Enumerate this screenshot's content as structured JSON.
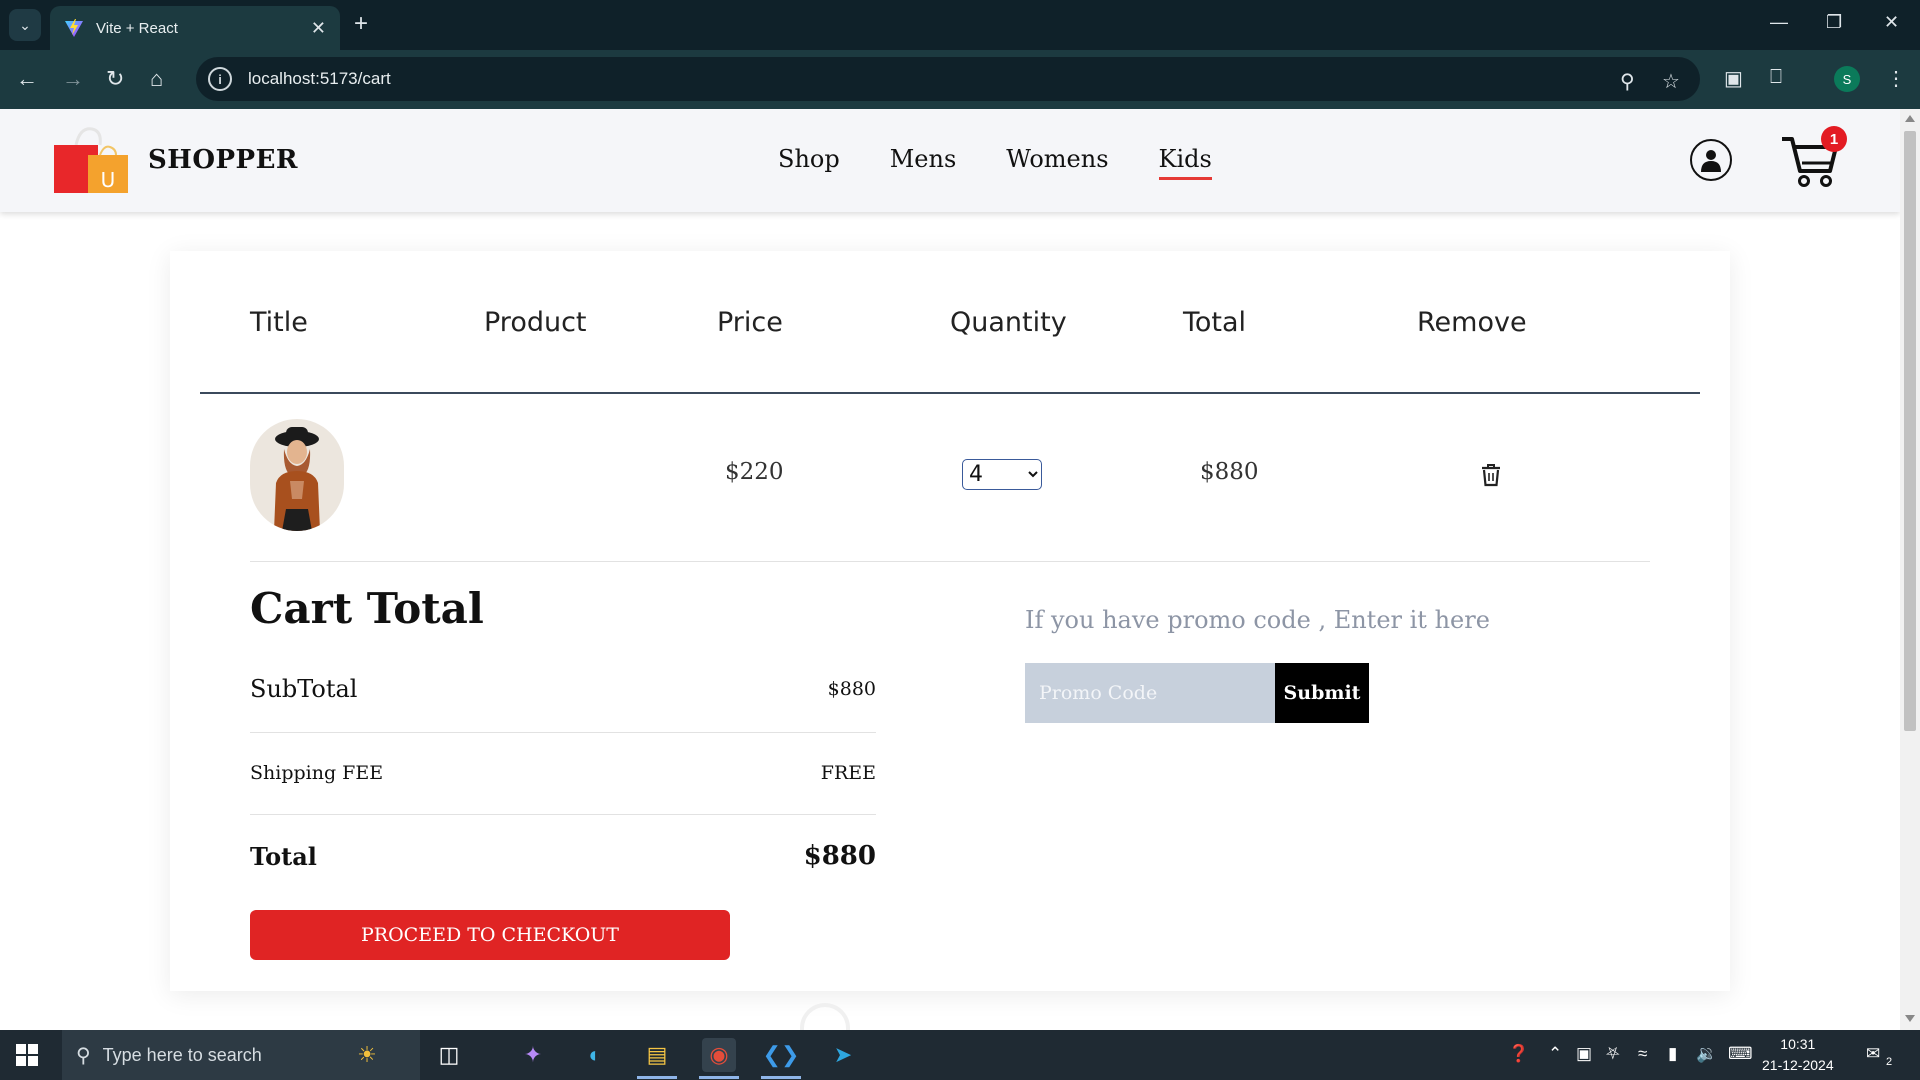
{
  "browser": {
    "tab_title": "Vite + React",
    "url": "localhost:5173/cart",
    "profile_initial": "S"
  },
  "site": {
    "brand": "SHOPPER",
    "nav": [
      "Shop",
      "Mens",
      "Womens",
      "Kids"
    ],
    "active_nav": "Kids",
    "cart_count": "1",
    "accent_color": "#e53935"
  },
  "cart": {
    "headers": [
      "Title",
      "Product",
      "Price",
      "Quantity",
      "Total",
      "Remove"
    ],
    "items": [
      {
        "title": "",
        "price": "$220",
        "quantity": "4",
        "total": "$880"
      }
    ],
    "totals": {
      "heading": "Cart Total",
      "subtotal_label": "SubTotal",
      "subtotal_value": "$880",
      "shipping_label": "Shipping FEE",
      "shipping_value": "FREE",
      "total_label": "Total",
      "total_value": "$880"
    },
    "checkout_label": "PROCEED TO CHECKOUT",
    "promo": {
      "prompt": "If you have promo code , Enter it here",
      "placeholder": "Promo Code",
      "submit_label": "Submit"
    }
  },
  "taskbar": {
    "search_placeholder": "Type here to search",
    "time": "10:31",
    "date": "21-12-2024",
    "notification_count": "2"
  }
}
